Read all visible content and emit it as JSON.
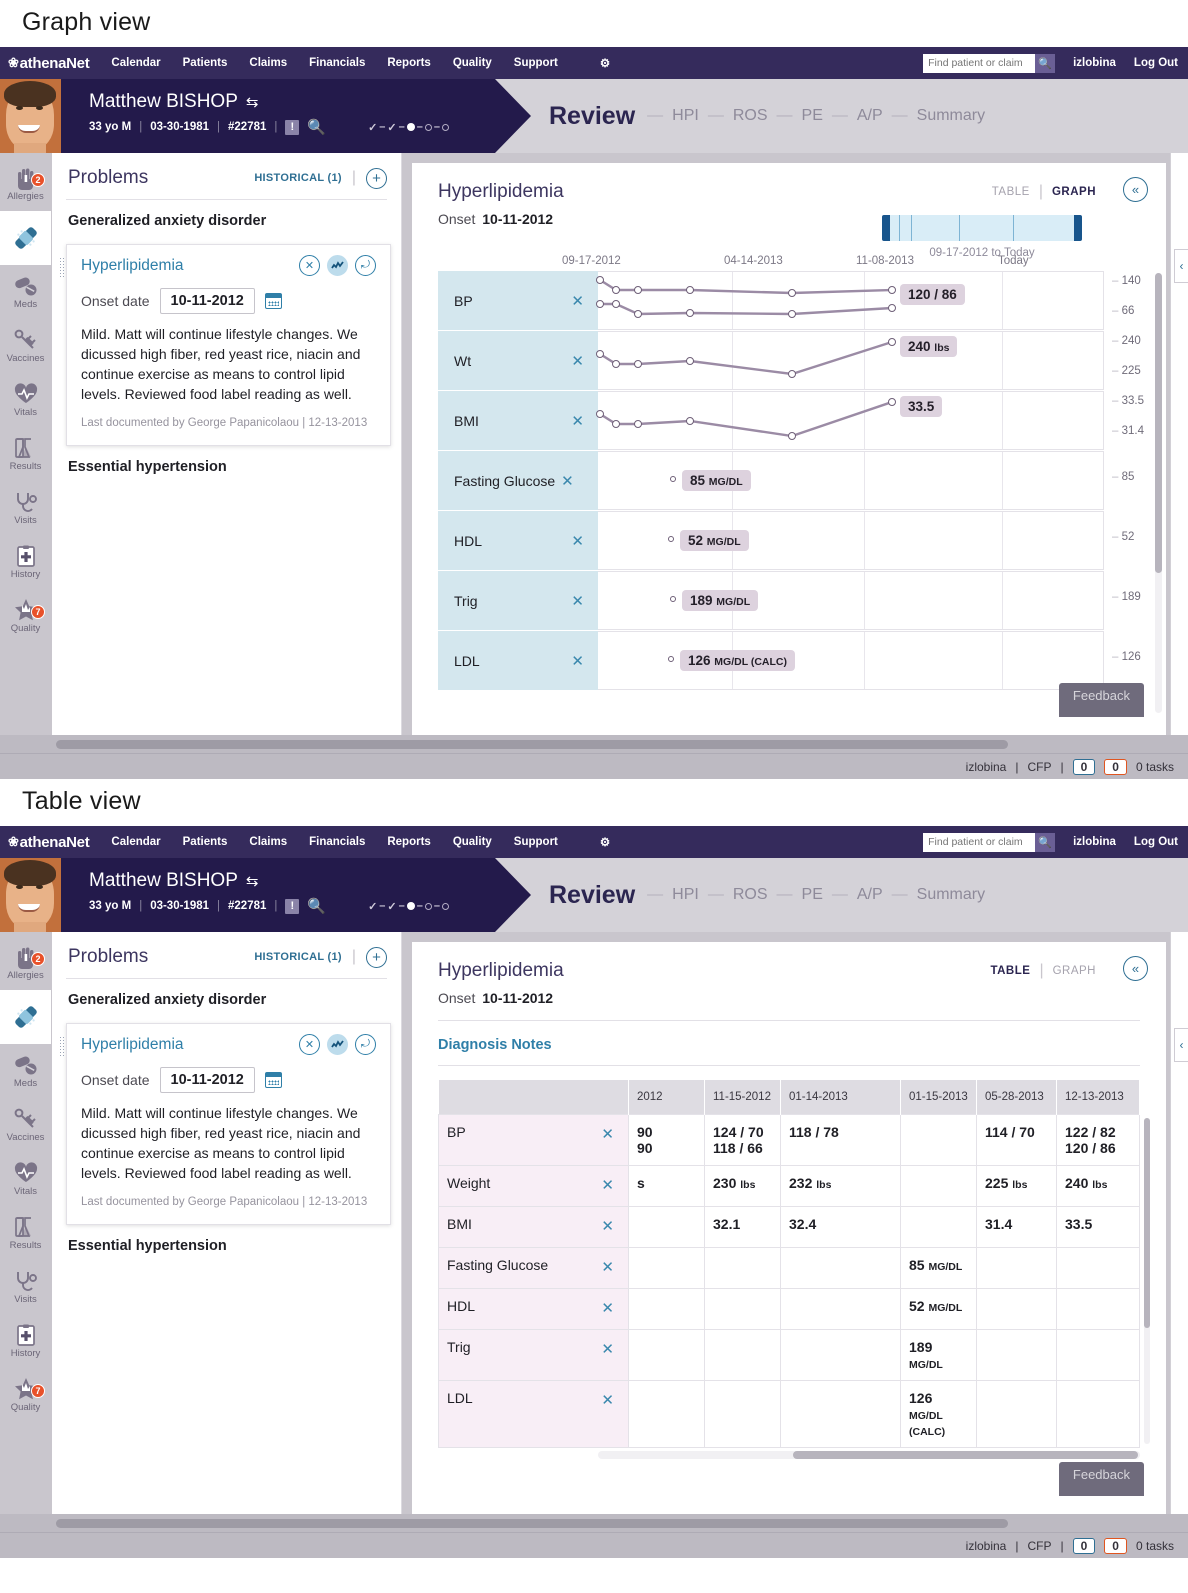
{
  "captions": {
    "graph": "Graph view",
    "table": "Table view"
  },
  "topnav": {
    "brand": "athenaNet",
    "items": [
      "Calendar",
      "Patients",
      "Claims",
      "Financials",
      "Reports",
      "Quality",
      "Support"
    ],
    "gear_icon": "gear-icon",
    "search_placeholder": "Find patient or claim",
    "search_value": "",
    "username": "izlobina",
    "logout": "Log Out"
  },
  "patient": {
    "name": "Matthew BISHOP",
    "age_sex": "33 yo M",
    "dob": "03-30-1981",
    "chart_id": "#22781",
    "alert_icon": "alert-icon",
    "search_icon": "search-icon",
    "swap_icon": "swap-patient-icon",
    "progress": [
      "check",
      "check",
      "filled",
      "open",
      "open"
    ]
  },
  "review": {
    "title": "Review",
    "steps": [
      "HPI",
      "ROS",
      "PE",
      "A/P",
      "Summary"
    ]
  },
  "rail": [
    {
      "label": "Allergies",
      "icon": "allergies-hand-icon",
      "badge": "2",
      "active": false
    },
    {
      "label": "",
      "icon": "problems-bandage-icon",
      "badge": "",
      "active": true
    },
    {
      "label": "Meds",
      "icon": "meds-pill-icon",
      "badge": "",
      "active": false
    },
    {
      "label": "Vaccines",
      "icon": "vaccines-syringe-icon",
      "badge": "",
      "active": false
    },
    {
      "label": "Vitals",
      "icon": "vitals-heart-icon",
      "badge": "",
      "active": false
    },
    {
      "label": "Results",
      "icon": "results-flask-icon",
      "badge": "",
      "active": false
    },
    {
      "label": "Visits",
      "icon": "visits-stethoscope-icon",
      "badge": "",
      "active": false
    },
    {
      "label": "History",
      "icon": "history-clipboard-icon",
      "badge": "",
      "active": false
    },
    {
      "label": "Quality",
      "icon": "quality-star-icon",
      "badge": "7",
      "active": false
    }
  ],
  "problems": {
    "title": "Problems",
    "historical_label": "HISTORICAL (1)",
    "add_icon": "plus-icon",
    "item_above": "Generalized anxiety disorder",
    "item_below": "Essential hypertension",
    "card": {
      "title": "Hyperlipidemia",
      "close_icon": "close-icon",
      "graph_icon": "trend-graph-icon",
      "share_icon": "share-icon",
      "onset_label": "Onset date",
      "onset_value": "10-11-2012",
      "calendar_icon": "calendar-icon",
      "note": "Mild. Matt will continue lifestyle changes. We dicussed high fiber, red yeast rice, niacin and continue exercise as means to control lipid levels. Reviewed food label reading as well.",
      "meta": "Last documented by George Papanicolaou | 12-13-2013"
    }
  },
  "detail": {
    "title": "Hyperlipidemia",
    "onset_label": "Onset",
    "onset_value": "10-11-2012",
    "tab_table": "TABLE",
    "tab_graph": "GRAPH",
    "collapse_icon": "collapse-panel-icon",
    "dx_notes_label": "Diagnosis Notes",
    "range_label": "09-17-2012 to Today"
  },
  "footer": {
    "feedback": "Feedback",
    "username": "izlobina",
    "dept": "CFP",
    "count_blue": "0",
    "count_orange": "0",
    "tasks": "0 tasks"
  },
  "chart_data": {
    "type": "line",
    "title": "Hyperlipidemia",
    "xlabel": "",
    "ylabel": "",
    "grid": true,
    "legend_position": "none",
    "x_ticks": [
      "09-17-2012",
      "04-14-2013",
      "11-08-2013",
      "Today"
    ],
    "range": "09-17-2012 to Today",
    "rows": [
      {
        "label": "BP",
        "axis_max": "140",
        "axis_min": "66",
        "latest_badge": "120 / 86",
        "unit": "",
        "series": [
          {
            "name": "systolic",
            "values": [
              140,
              131,
              130,
              130,
              129,
              130
            ]
          },
          {
            "name": "diastolic",
            "values": [
              82,
              82,
              66,
              70,
              70,
              86
            ]
          }
        ]
      },
      {
        "label": "Wt",
        "axis_max": "240",
        "axis_min": "225",
        "latest_badge": "240",
        "unit": "lbs",
        "series": [
          {
            "name": "weight",
            "values": [
              234,
              230,
              230,
              232,
              225,
              240
            ]
          }
        ]
      },
      {
        "label": "BMI",
        "axis_max": "33.5",
        "axis_min": "31.4",
        "latest_badge": "33.5",
        "unit": "",
        "series": [
          {
            "name": "bmi",
            "values": [
              32.6,
              32.1,
              32.1,
              32.4,
              31.4,
              33.5
            ]
          }
        ]
      },
      {
        "label": "Fasting Glucose",
        "axis_max": "85",
        "axis_min": "",
        "latest_badge": "85",
        "unit": "MG/DL",
        "series": [
          {
            "name": "fasting-glucose",
            "values": [
              85
            ]
          }
        ]
      },
      {
        "label": "HDL",
        "axis_max": "52",
        "axis_min": "",
        "latest_badge": "52",
        "unit": "MG/DL",
        "series": [
          {
            "name": "hdl",
            "values": [
              52
            ]
          }
        ]
      },
      {
        "label": "Trig",
        "axis_max": "189",
        "axis_min": "",
        "latest_badge": "189",
        "unit": "MG/DL",
        "series": [
          {
            "name": "trig",
            "values": [
              189
            ]
          }
        ]
      },
      {
        "label": "LDL",
        "axis_max": "126",
        "axis_min": "",
        "latest_badge": "126",
        "unit": "MG/DL (CALC)",
        "series": [
          {
            "name": "ldl",
            "values": [
              126
            ]
          }
        ]
      }
    ]
  },
  "table": {
    "type": "table",
    "columns": [
      "",
      "",
      "2012",
      "11-15-2012",
      "01-14-2013",
      "01-15-2013",
      "05-28-2013",
      "12-13-2013"
    ],
    "rows": [
      {
        "label": "BP",
        "cells": [
          "90\n90",
          "124 / 70\n118 / 66",
          "118 / 78",
          "",
          "114 / 70",
          "122 / 82\n120 / 86"
        ]
      },
      {
        "label": "Weight",
        "cells": [
          "s",
          "230 lbs",
          "232 lbs",
          "",
          "225 lbs",
          "240 lbs"
        ]
      },
      {
        "label": "BMI",
        "cells": [
          "",
          "32.1",
          "32.4",
          "",
          "31.4",
          "33.5"
        ]
      },
      {
        "label": "Fasting Glucose",
        "cells": [
          "",
          "",
          "",
          "85 MG/DL",
          "",
          ""
        ]
      },
      {
        "label": "HDL",
        "cells": [
          "",
          "",
          "",
          "52 MG/DL",
          "",
          ""
        ]
      },
      {
        "label": "Trig",
        "cells": [
          "",
          "",
          "",
          "189 MG/DL",
          "",
          ""
        ]
      },
      {
        "label": "LDL",
        "cells": [
          "",
          "",
          "",
          "126 MG/DL (CALC)",
          "",
          ""
        ]
      }
    ]
  }
}
